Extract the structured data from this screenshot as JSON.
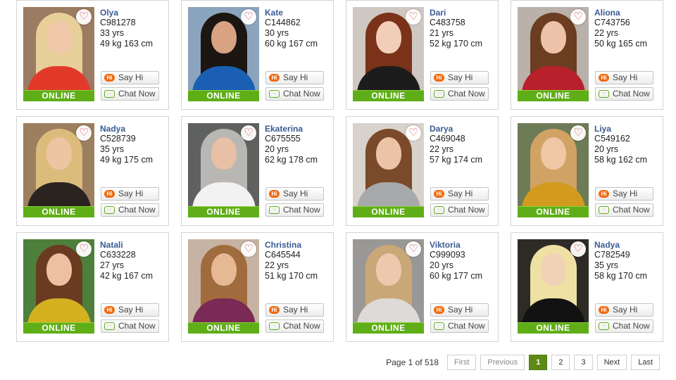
{
  "profiles": [
    {
      "name": "Olya",
      "id": "C981278",
      "age": "33 yrs",
      "stats": "49 kg 163 cm",
      "status": "ONLINE"
    },
    {
      "name": "Kate",
      "id": "C144862",
      "age": "30 yrs",
      "stats": "60 kg 167 cm",
      "status": "ONLINE"
    },
    {
      "name": "Dari",
      "id": "C483758",
      "age": "21 yrs",
      "stats": "52 kg 170 cm",
      "status": "ONLINE"
    },
    {
      "name": "Aliona",
      "id": "C743756",
      "age": "22 yrs",
      "stats": "50 kg 165 cm",
      "status": "ONLINE"
    },
    {
      "name": "Nadya",
      "id": "C528739",
      "age": "35 yrs",
      "stats": "49 kg 175 cm",
      "status": "ONLINE"
    },
    {
      "name": "Ekaterina",
      "id": "C675555",
      "age": "20 yrs",
      "stats": "62 kg 178 cm",
      "status": "ONLINE"
    },
    {
      "name": "Darya",
      "id": "C469048",
      "age": "22 yrs",
      "stats": "57 kg 174 cm",
      "status": "ONLINE"
    },
    {
      "name": "Liya",
      "id": "C549162",
      "age": "20 yrs",
      "stats": "58 kg 162 cm",
      "status": "ONLINE"
    },
    {
      "name": "Natali",
      "id": "C633228",
      "age": "27 yrs",
      "stats": "42 kg 167 cm",
      "status": "ONLINE"
    },
    {
      "name": "Christina",
      "id": "C645544",
      "age": "22 yrs",
      "stats": "51 kg 170 cm",
      "status": "ONLINE"
    },
    {
      "name": "Viktoria",
      "id": "C999093",
      "age": "20 yrs",
      "stats": "60 kg 177 cm",
      "status": "ONLINE"
    },
    {
      "name": "Nadya",
      "id": "C782549",
      "age": "35 yrs",
      "stats": "58 kg 170 cm",
      "status": "ONLINE"
    }
  ],
  "buttons": {
    "say_hi": "Say Hi",
    "chat_now": "Chat Now",
    "hi_icon_text": "Hi"
  },
  "photo_palettes": [
    {
      "bg": "#9b7b62",
      "hair": "#e7cf9a",
      "face": "#f1c9aa",
      "top": "#e23a2a"
    },
    {
      "bg": "#8aa4bd",
      "hair": "#1c1612",
      "face": "#d9a283",
      "top": "#1a5fb4"
    },
    {
      "bg": "#cfc8c2",
      "hair": "#7a3218",
      "face": "#f2cdb8",
      "top": "#1c1c1c"
    },
    {
      "bg": "#b9b1aa",
      "hair": "#6b3e22",
      "face": "#edc4a9",
      "top": "#b8202c"
    },
    {
      "bg": "#9c7f5f",
      "hair": "#dcbc7c",
      "face": "#edc5a2",
      "top": "#2a2320"
    },
    {
      "bg": "#5e6160",
      "hair": "#b9b7b3",
      "face": "#e7c0a6",
      "top": "#f2f2f2"
    },
    {
      "bg": "#d8d2cc",
      "hair": "#7a4a2a",
      "face": "#ebc4a8",
      "top": "#a8a9ab"
    },
    {
      "bg": "#6d7b57",
      "hair": "#d0a264",
      "face": "#eec7a5",
      "top": "#d39b1e"
    },
    {
      "bg": "#4e7f3b",
      "hair": "#6a3b21",
      "face": "#edc0a1",
      "top": "#d4b11f"
    },
    {
      "bg": "#c7b3a3",
      "hair": "#a06c3d",
      "face": "#e7b894",
      "top": "#7b2a55"
    },
    {
      "bg": "#9a9896",
      "hair": "#caa777",
      "face": "#edc8ad",
      "top": "#dddad7"
    },
    {
      "bg": "#2e2b27",
      "hair": "#efe1a4",
      "face": "#f2d2b6",
      "top": "#121212"
    }
  ],
  "pagination": {
    "page_label": "Page",
    "current": "1",
    "of_label": "of",
    "total": "518",
    "first": "First",
    "previous": "Previous",
    "pages": [
      "1",
      "2",
      "3"
    ],
    "next": "Next",
    "last": "Last"
  },
  "colors": {
    "online": "#5fae17",
    "name": "#3a5a93",
    "active_page": "#5d8a17",
    "favorite": "#e0384a"
  }
}
